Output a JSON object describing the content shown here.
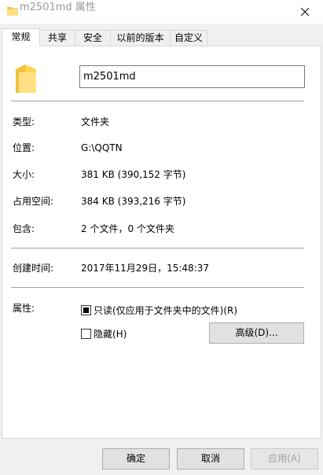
{
  "window": {
    "title": "m2501md 属性"
  },
  "tabs": [
    {
      "label": "常规"
    },
    {
      "label": "共享"
    },
    {
      "label": "安全"
    },
    {
      "label": "以前的版本"
    },
    {
      "label": "自定义"
    }
  ],
  "general": {
    "name_value": "m2501md",
    "type": {
      "label": "类型:",
      "value": "文件夹"
    },
    "location": {
      "label": "位置:",
      "value": "G:\\QQTN"
    },
    "size": {
      "label": "大小:",
      "value": "381 KB (390,152 字节)"
    },
    "size_on_disk": {
      "label": "占用空间:",
      "value": "384 KB (393,216 字节)"
    },
    "contains": {
      "label": "包含:",
      "value": "2 个文件，0 个文件夹"
    },
    "created": {
      "label": "创建时间:",
      "value": "2017年11月29日，15:48:37"
    },
    "attributes": {
      "label": "属性:",
      "readonly_label": "只读(仅应用于文件夹中的文件)(R)",
      "hidden_label": "隐藏(H)",
      "advanced_label": "高级(D)..."
    }
  },
  "footer": {
    "ok_label": "确定",
    "cancel_label": "取消",
    "apply_label": "应用(A)"
  },
  "colors": {
    "folder_light": "#ffe082",
    "folder_dark": "#f0c040"
  },
  "icons": {
    "folder": "folder-icon",
    "close": "close-icon"
  }
}
